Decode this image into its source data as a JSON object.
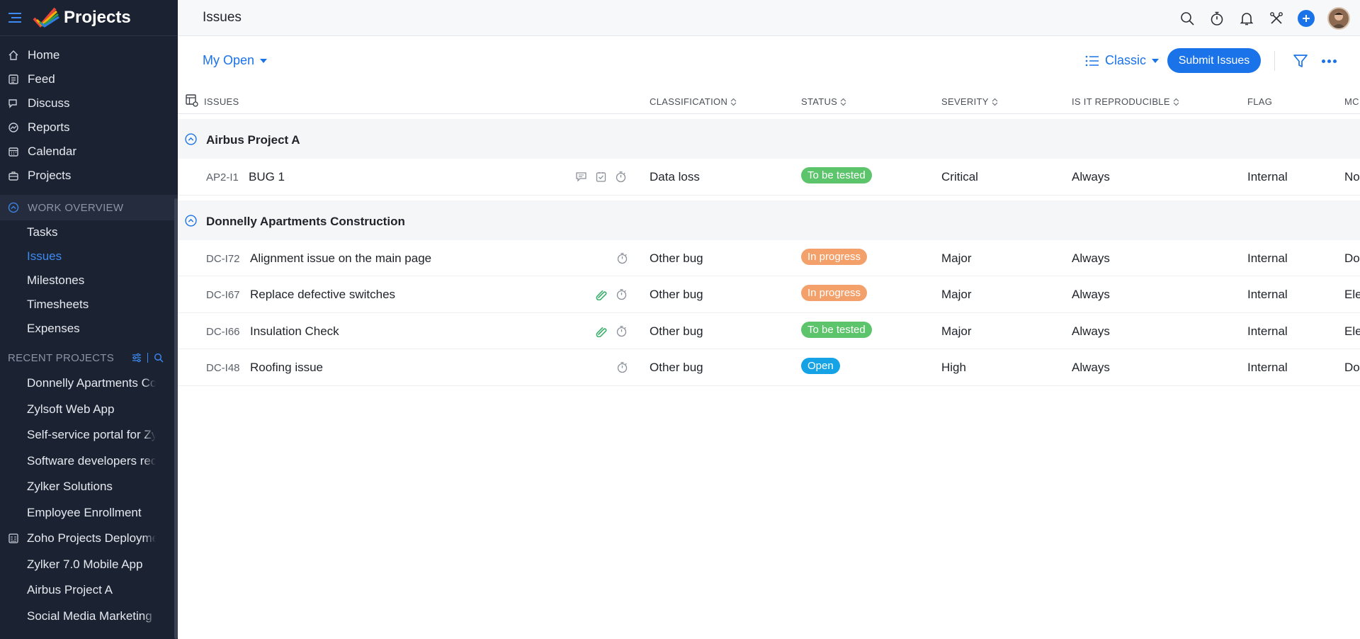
{
  "sidebar": {
    "brand": "Projects",
    "nav": [
      {
        "label": "Home",
        "icon": "home-icon"
      },
      {
        "label": "Feed",
        "icon": "feed-icon"
      },
      {
        "label": "Discuss",
        "icon": "discuss-icon"
      },
      {
        "label": "Reports",
        "icon": "reports-icon"
      },
      {
        "label": "Calendar",
        "icon": "calendar-icon"
      },
      {
        "label": "Projects",
        "icon": "projects-icon"
      }
    ],
    "work_overview": {
      "title": "WORK OVERVIEW",
      "items": [
        "Tasks",
        "Issues",
        "Milestones",
        "Timesheets",
        "Expenses"
      ],
      "active": "Issues"
    },
    "recent": {
      "title": "RECENT PROJECTS",
      "items": [
        "Donnelly Apartments Construction",
        "Zylsoft Web App",
        "Self-service portal for Zylker",
        "Software developers recruitment",
        "Zylker Solutions",
        "Employee Enrollment",
        "Zoho Projects Deployment",
        "Zylker 7.0 Mobile App",
        "Airbus Project A",
        "Social Media Marketing"
      ]
    }
  },
  "topbar": {
    "title": "Issues"
  },
  "toolbar": {
    "view": "My Open",
    "layout": "Classic",
    "submit_label": "Submit Issues"
  },
  "table": {
    "columns": {
      "issues": "ISSUES",
      "classification": "CLASSIFICATION",
      "status": "STATUS",
      "severity": "SEVERITY",
      "reproducible": "IS IT REPRODUCIBLE",
      "flag": "FLAG",
      "module": "MC"
    },
    "groups": [
      {
        "name": "Airbus Project A",
        "rows": [
          {
            "id": "AP2-I1",
            "title": "BUG 1",
            "classification": "Data loss",
            "status": "To be tested",
            "severity": "Critical",
            "reproducible": "Always",
            "flag": "Internal",
            "module": "No"
          }
        ]
      },
      {
        "name": "Donnelly Apartments Construction",
        "rows": [
          {
            "id": "DC-I72",
            "title": "Alignment issue on the main page",
            "classification": "Other bug",
            "status": "In progress",
            "severity": "Major",
            "reproducible": "Always",
            "flag": "Internal",
            "module": "Do"
          },
          {
            "id": "DC-I67",
            "title": "Replace defective switches",
            "classification": "Other bug",
            "status": "In progress",
            "severity": "Major",
            "reproducible": "Always",
            "flag": "Internal",
            "module": "Ele"
          },
          {
            "id": "DC-I66",
            "title": "Insulation Check",
            "classification": "Other bug",
            "status": "To be tested",
            "severity": "Major",
            "reproducible": "Always",
            "flag": "Internal",
            "module": "Ele"
          },
          {
            "id": "DC-I48",
            "title": "Roofing issue",
            "classification": "Other bug",
            "status": "Open",
            "severity": "High",
            "reproducible": "Always",
            "flag": "Internal",
            "module": "Do"
          }
        ]
      }
    ]
  },
  "colors": {
    "accent": "#1a73e8",
    "sidebar_bg": "#1b2232",
    "status_to_be_tested": "#5cc46b",
    "status_in_progress": "#f3a06a",
    "status_open": "#15a3e6"
  }
}
